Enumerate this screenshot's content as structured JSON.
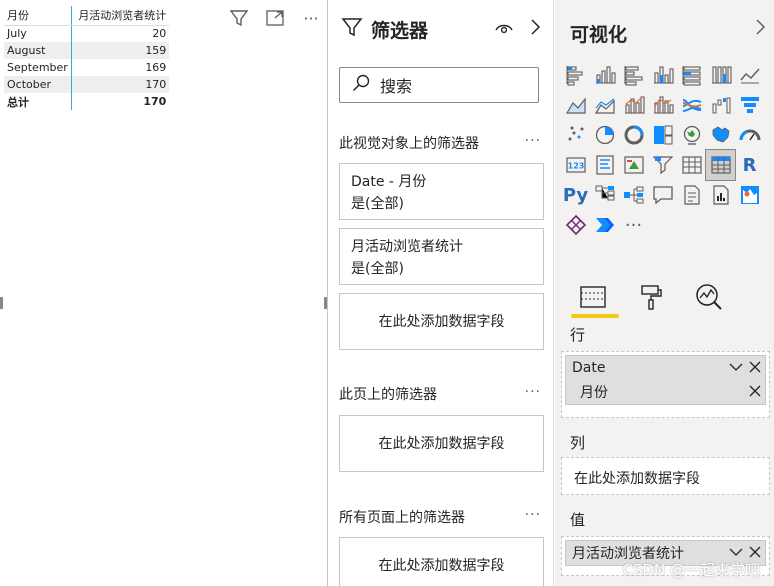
{
  "matrix": {
    "col_category": "月份",
    "col_value": "月活动浏览者统计",
    "rows": [
      {
        "label": "July",
        "value": "20"
      },
      {
        "label": "August",
        "value": "159"
      },
      {
        "label": "September",
        "value": "169"
      },
      {
        "label": "October",
        "value": "170"
      }
    ],
    "total": {
      "label": "总计",
      "value": "170"
    }
  },
  "visual_toolbar": {
    "icons": [
      "filter-icon",
      "focus-mode-icon",
      "more-options-icon"
    ],
    "more": "···"
  },
  "filters": {
    "title": "筛选器",
    "search_placeholder": "搜索",
    "visual_section": "此视觉对象上的筛选器",
    "page_section": "此页上的筛选器",
    "all_pages_section": "所有页面上的筛选器",
    "more": "···",
    "cards": [
      {
        "name": "Date - 月份",
        "state": "是(全部)"
      },
      {
        "name": "月活动浏览者统计",
        "state": "是(全部)"
      }
    ],
    "add_field": "在此处添加数据字段"
  },
  "viz": {
    "title": "可视化",
    "icon_names": [
      "stacked-bar-icon",
      "stacked-column-icon",
      "clustered-bar-icon",
      "clustered-column-icon",
      "100-stacked-bar-icon",
      "100-stacked-column-icon",
      "line-chart-icon",
      "area-chart-icon",
      "stacked-area-icon",
      "line-clustered-column-icon",
      "line-stacked-column-icon",
      "ribbon-chart-icon",
      "waterfall-icon",
      "funnel-icon",
      "scatter-icon",
      "pie-chart-icon",
      "donut-chart-icon",
      "treemap-icon",
      "map-icon",
      "filled-map-icon",
      "gauge-icon",
      "card-icon",
      "multi-row-card-icon",
      "kpi-icon",
      "slicer-icon",
      "table-icon",
      "matrix-icon",
      "r-visual-icon",
      "python-visual-icon",
      "key-influencers-icon",
      "decomposition-tree-icon",
      "qa-icon",
      "paginated-report-icon",
      "smart-narrative-icon",
      "arcgis-icon",
      "power-apps-icon",
      "power-automate-icon",
      "more-visuals-icon"
    ],
    "r_label": "R",
    "py_label": "Py",
    "more_label": "···",
    "tabs": [
      "fields-tab-icon",
      "format-tab-icon",
      "analytics-tab-icon"
    ],
    "rows_label": "行",
    "rows_field": "Date",
    "rows_subfield": "月份",
    "columns_label": "列",
    "columns_add": "在此处添加数据字段",
    "values_label": "值",
    "values_field": "月活动浏览者统计"
  },
  "watermark": "CSDN @一起来学吧",
  "colors": {
    "accent": "#f2c811",
    "visual_blue": "#118dff",
    "divider": "#3aa8c9"
  }
}
